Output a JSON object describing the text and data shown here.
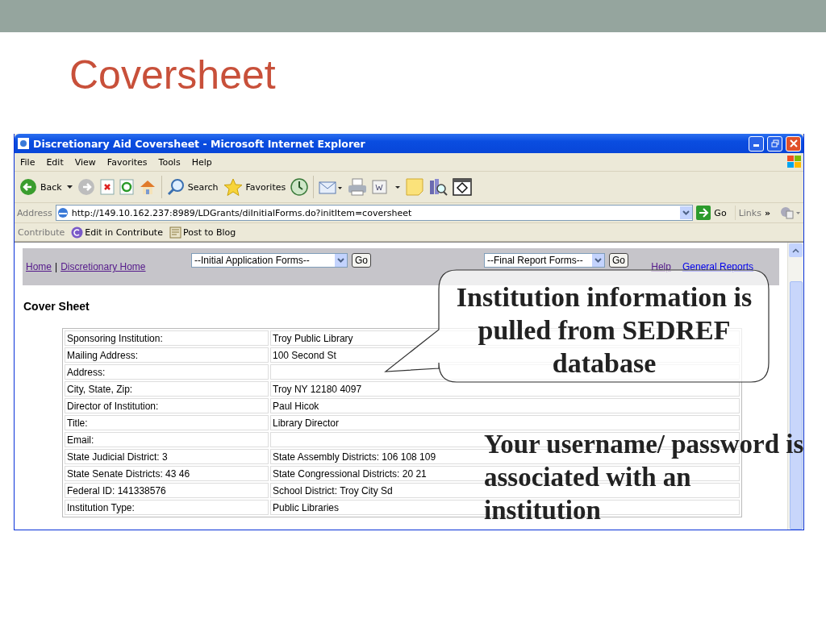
{
  "slide": {
    "title": "Coversheet"
  },
  "browser": {
    "title": "Discretionary Aid Coversheet - Microsoft Internet Explorer",
    "menu": [
      "File",
      "Edit",
      "View",
      "Favorites",
      "Tools",
      "Help"
    ],
    "toolbar": [
      {
        "kind": "back",
        "label": "Back"
      },
      {
        "kind": "forward"
      },
      {
        "kind": "stop"
      },
      {
        "kind": "refresh"
      },
      {
        "kind": "home"
      },
      {
        "kind": "search",
        "label": "Search"
      },
      {
        "kind": "favorites",
        "label": "Favorites"
      },
      {
        "kind": "history"
      },
      {
        "kind": "mail"
      },
      {
        "kind": "print"
      },
      {
        "kind": "word"
      },
      {
        "kind": "note"
      },
      {
        "kind": "research"
      },
      {
        "kind": "frame"
      }
    ],
    "address": {
      "label": "Address",
      "url": "http://149.10.162.237:8989/LDGrants/diInitialForms.do?initItem=coversheet",
      "go": "Go",
      "links": "Links",
      "more": "»"
    },
    "contribute": {
      "label": "Contribute",
      "items": [
        {
          "kind": "contribute",
          "label": "Edit in Contribute"
        },
        {
          "kind": "blog",
          "label": "Post to Blog"
        }
      ]
    },
    "page": {
      "nav_links": [
        {
          "label": "Home",
          "visited": true
        },
        {
          "label": "Discretionary Home",
          "visited": true
        }
      ],
      "separator": "|",
      "selects": [
        {
          "value": "--Initial Application Forms--",
          "button": "Go"
        },
        {
          "value": "--Final Report Forms--",
          "button": "Go"
        }
      ],
      "help_links": [
        {
          "label": "Help",
          "visited": true
        },
        {
          "label": "General Reports",
          "visited": false
        }
      ],
      "heading": "Cover Sheet",
      "rows": [
        {
          "label": "Sponsoring Institution:",
          "value": "Troy Public Library"
        },
        {
          "label": "Mailing Address:",
          "value": "100 Second St"
        },
        {
          "label": "Address:"
        },
        {
          "label": "City, State, Zip:",
          "value": "Troy NY 12180 4097"
        },
        {
          "label": "Director of Institution:",
          "value": "Paul Hicok"
        },
        {
          "label": "Title:",
          "value": "Library Director"
        },
        {
          "label": "Email:"
        },
        {
          "label": "State Judicial District: 3",
          "value": "State Assembly Districts: 106 108 109"
        },
        {
          "label": "State Senate Districts: 43 46",
          "value": "State Congressional Districts: 20 21"
        },
        {
          "label": "Federal ID: 141338576",
          "value": "School District: Troy City Sd"
        },
        {
          "label": "Institution Type:",
          "value": "Public Libraries"
        }
      ]
    }
  },
  "callouts": [
    {
      "kind": "bubble",
      "text": "Institution information is pulled from SEDREF database"
    },
    {
      "kind": "plain",
      "text": "Your username/ password is associated with an institution"
    }
  ]
}
